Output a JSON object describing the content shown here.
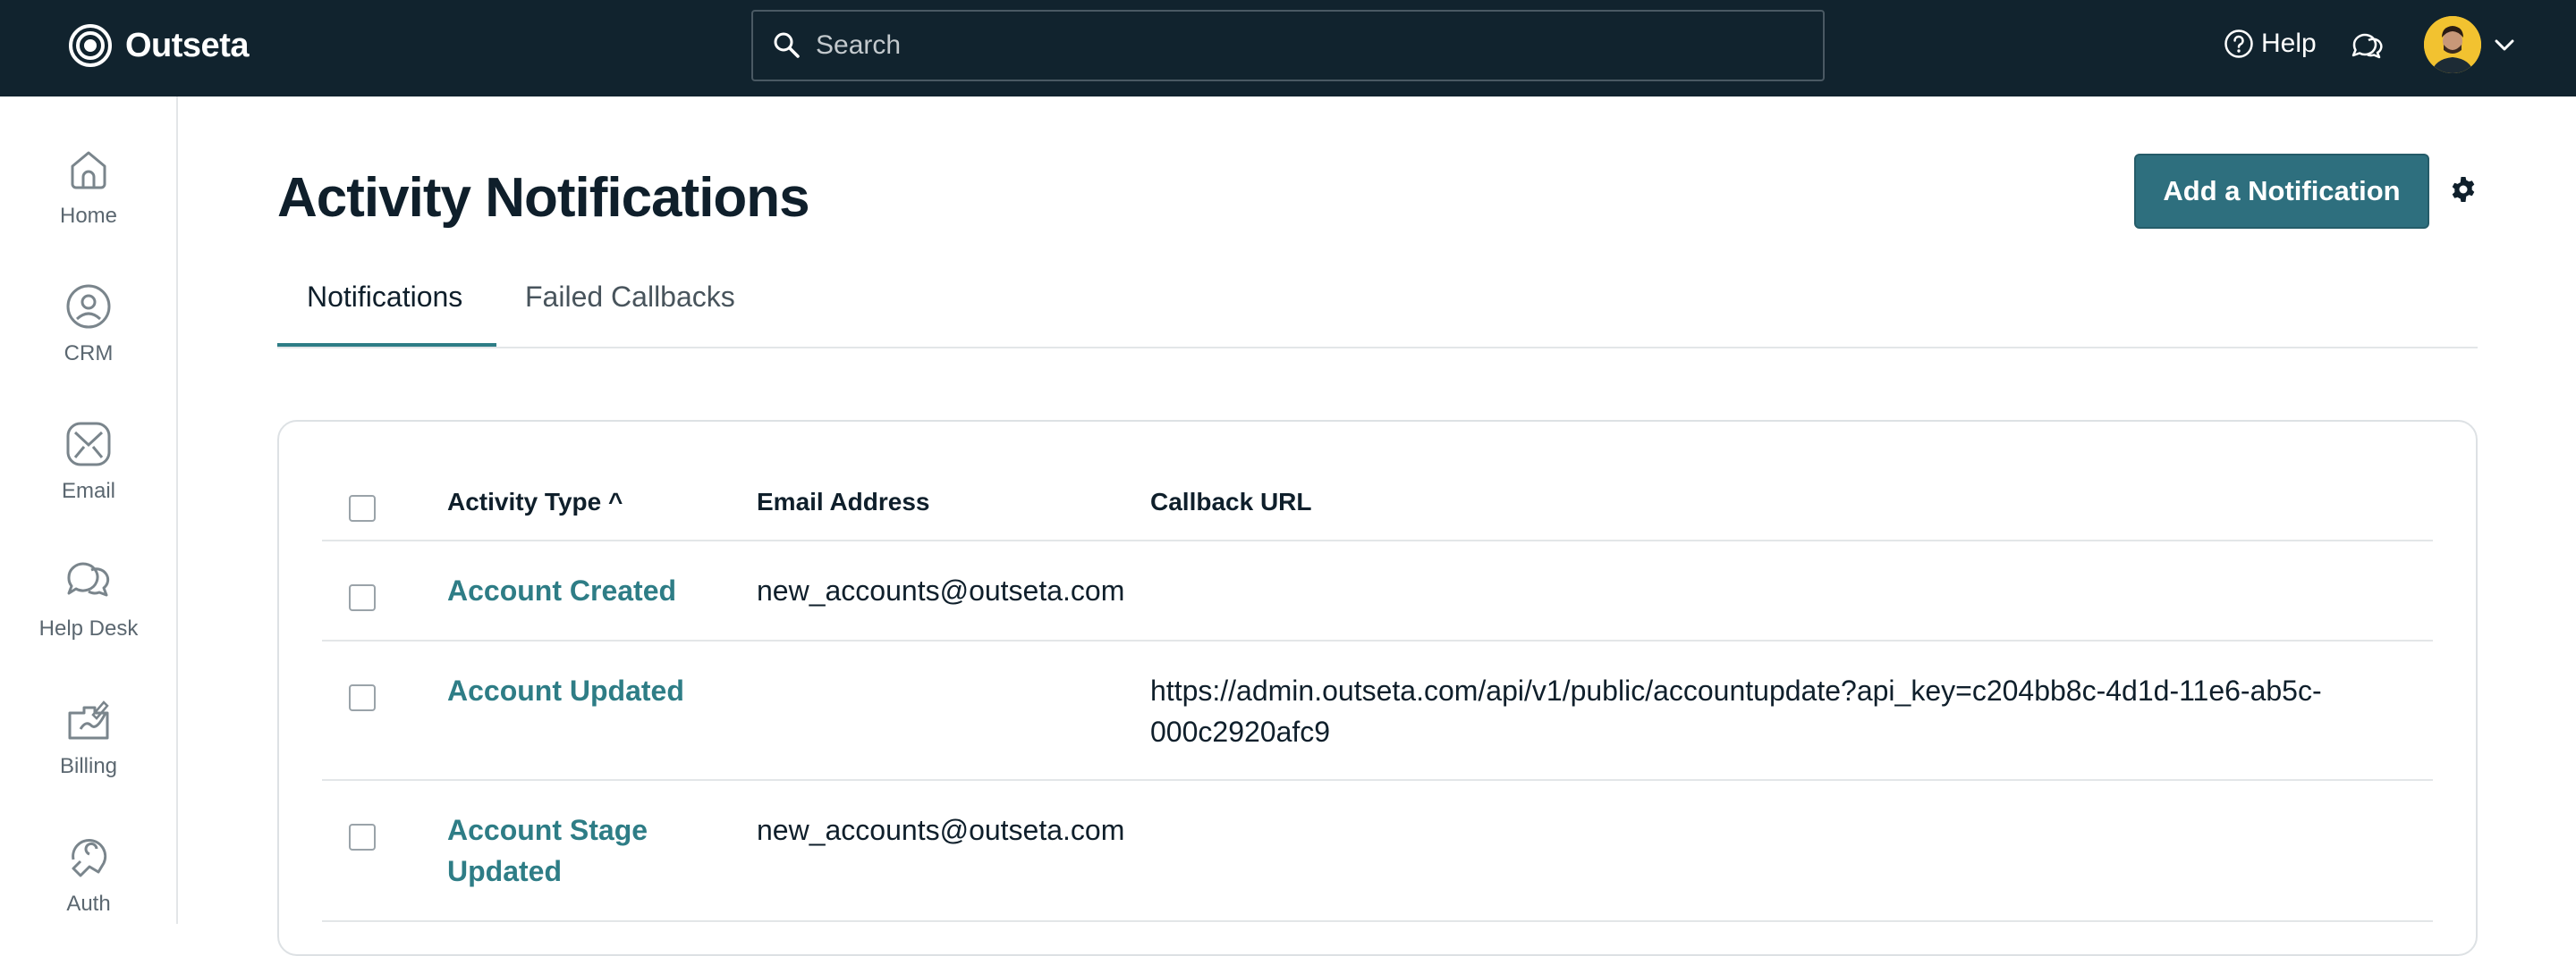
{
  "brand": {
    "name": "Outseta"
  },
  "search": {
    "placeholder": "Search"
  },
  "topnav": {
    "help_label": "Help"
  },
  "sidebar": {
    "items": [
      {
        "label": "Home",
        "icon": "home-icon"
      },
      {
        "label": "CRM",
        "icon": "person-circle-icon"
      },
      {
        "label": "Email",
        "icon": "envelope-icon"
      },
      {
        "label": "Help Desk",
        "icon": "chat-bubbles-icon"
      },
      {
        "label": "Billing",
        "icon": "billing-icon"
      },
      {
        "label": "Auth",
        "icon": "auth-icon"
      }
    ]
  },
  "page": {
    "title": "Activity Notifications",
    "add_button": "Add a Notification"
  },
  "tabs": [
    {
      "label": "Notifications",
      "active": true
    },
    {
      "label": "Failed Callbacks",
      "active": false
    }
  ],
  "table": {
    "columns": {
      "activity_type": "Activity Type",
      "sort_indicator": "^",
      "email": "Email Address",
      "callback": "Callback URL"
    },
    "rows": [
      {
        "activity": "Account Created",
        "email": "new_accounts@outseta.com",
        "callback": ""
      },
      {
        "activity": "Account Updated",
        "email": "",
        "callback_line1": "https://admin.outseta.com/api/v1/public/accountupdate?api_key=c204bb8c-4d1d-11e6-ab5c-",
        "callback_line2": "000c2920afc9"
      },
      {
        "activity_line1": "Account Stage",
        "activity_line2": "Updated",
        "email": "new_accounts@outseta.com",
        "callback": ""
      }
    ]
  },
  "colors": {
    "topbar": "#11232e",
    "accent": "#2e6f7e",
    "link": "#2e7d86"
  }
}
